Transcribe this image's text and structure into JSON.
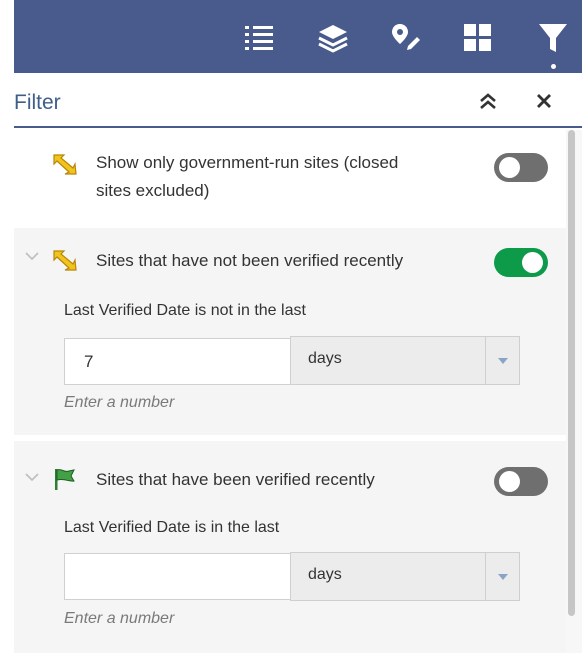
{
  "toolbar": {
    "icons": [
      "list-icon",
      "layers-icon",
      "draw-icon",
      "grid-icon",
      "filter-icon"
    ],
    "active": "filter-icon",
    "color": "#485b8c"
  },
  "panel": {
    "title": "Filter",
    "collapse_icon": "double-chevron-up-icon",
    "close_icon": "close-icon"
  },
  "filters": [
    {
      "label_line1": "Show only government-run sites (closed",
      "label_line2": "sites excluded)",
      "icon": "yellow-arrow-icon",
      "enabled": false,
      "expandable": false
    },
    {
      "label": "Sites that have not been verified recently",
      "icon": "yellow-arrow-icon",
      "enabled": true,
      "expandable": true,
      "expression": "Last Verified Date is not in the last",
      "value": "7",
      "unit": "days",
      "hint": "Enter a number"
    },
    {
      "label": "Sites that have been verified recently",
      "icon": "green-flag-icon",
      "enabled": false,
      "expandable": true,
      "expression": "Last Verified Date is in the last",
      "value": "",
      "unit": "days",
      "hint": "Enter a number"
    }
  ],
  "colors": {
    "toggle_on": "#0d9b4a",
    "toggle_off": "#6f6f6f",
    "title": "#3e5f8a"
  }
}
